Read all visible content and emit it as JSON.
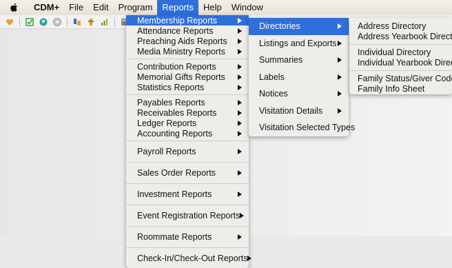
{
  "menubar": {
    "app": "CDM+",
    "items": [
      "File",
      "Edit",
      "Program",
      "Reports",
      "Help",
      "Window"
    ]
  },
  "toolbar": {
    "icons": [
      "heart-icon",
      "checkbox-icon",
      "person-icon",
      "disc-icon",
      "split-icon",
      "money-icon",
      "bar-chart-icon",
      "calculator-icon"
    ]
  },
  "reports_menu": {
    "groups": [
      [
        "Membership Reports",
        "Attendance Reports",
        "Preaching Aids Reports",
        "Media Ministry Reports"
      ],
      [
        "Contribution Reports",
        "Memorial Gifts Reports",
        "Statistics Reports"
      ],
      [
        "Payables Reports",
        "Receivables Reports",
        "Ledger Reports",
        "Accounting Reports"
      ],
      [
        "Payroll Reports"
      ],
      [
        "Sales Order Reports"
      ],
      [
        "Investment Reports"
      ],
      [
        "Event Registration Reports"
      ],
      [
        "Roommate Reports"
      ],
      [
        "Check-In/Check-Out Reports"
      ]
    ]
  },
  "membership_menu": {
    "items": [
      "Directories",
      "Listings and Exports",
      "Summaries",
      "Labels",
      "Notices",
      "Visitation Details",
      "Visitation Selected Types"
    ]
  },
  "directories_menu": {
    "groups": [
      [
        "Address Directory",
        "Address Yearbook Directory"
      ],
      [
        "Individual Directory",
        "Individual Yearbook Directory"
      ],
      [
        "Family Status/Giver Code",
        "Family Info Sheet"
      ]
    ]
  },
  "colors": {
    "highlight": "#2f6fdc",
    "menu_bg": "#efedea"
  }
}
